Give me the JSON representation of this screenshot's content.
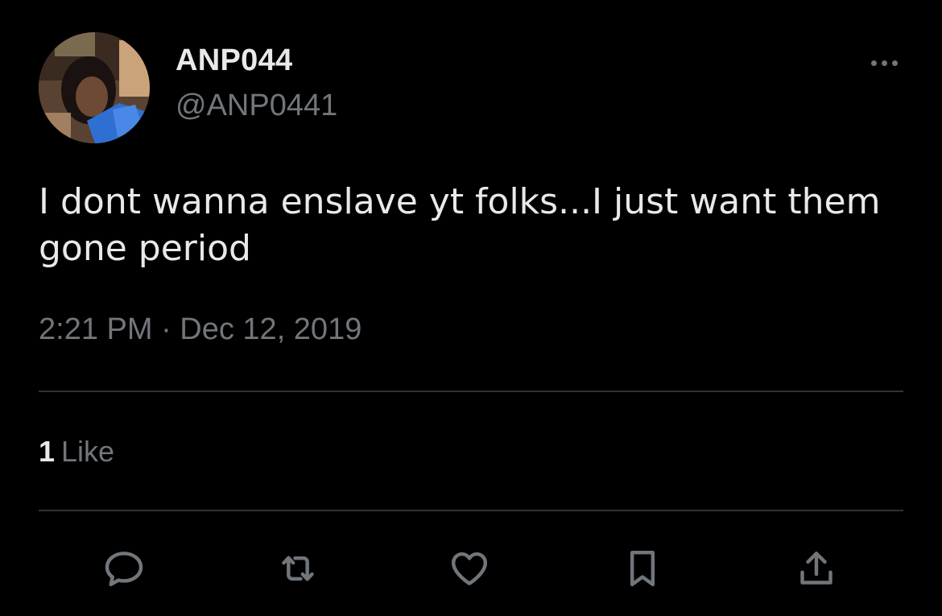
{
  "tweet": {
    "display_name": "ANP044",
    "handle": "@ANP0441",
    "text": "I dont wanna enslave yt folks...I just want them gone period",
    "timestamp": "2:21 PM · Dec 12, 2019"
  },
  "stats": {
    "like_count": "1",
    "like_label": "Like"
  },
  "actions": [
    {
      "icon": "reply-icon"
    },
    {
      "icon": "retweet-icon"
    },
    {
      "icon": "heart-icon"
    },
    {
      "icon": "bookmark-icon"
    },
    {
      "icon": "share-icon"
    }
  ],
  "colors": {
    "background": "#000000",
    "primary_text": "#e7e9ea",
    "secondary_text": "#71767b",
    "divider": "#2f3336"
  }
}
